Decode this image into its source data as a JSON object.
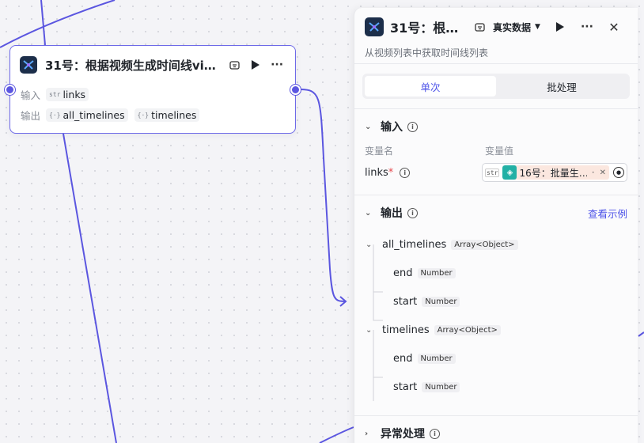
{
  "node": {
    "title": "31号：根据视频生成时间线vi…",
    "input_label": "输入",
    "output_label": "输出",
    "inputs": [
      {
        "icon": "str",
        "name": "links"
      }
    ],
    "outputs": [
      {
        "icon": "{·}",
        "name": "all_timelines"
      },
      {
        "icon": "{·}",
        "name": "timelines"
      }
    ]
  },
  "panel": {
    "title": "31号：根…",
    "data_mode": "真实数据",
    "description": "从视频列表中获取时间线列表",
    "tabs": [
      "单次",
      "批处理"
    ],
    "input_section": {
      "title": "输入",
      "col_name": "变量名",
      "col_value": "变量值",
      "var_name": "links",
      "required_mark": "*",
      "var_type_icon": "str",
      "ref_label": "16号：批量生…",
      "ref_suffix": "·"
    },
    "output_section": {
      "title": "输出",
      "view_example": "查看示例",
      "tree": [
        {
          "name": "all_timelines",
          "type": "Array<Object>",
          "children": [
            {
              "name": "end",
              "type": "Number"
            },
            {
              "name": "start",
              "type": "Number"
            }
          ]
        },
        {
          "name": "timelines",
          "type": "Array<Object>",
          "children": [
            {
              "name": "end",
              "type": "Number"
            },
            {
              "name": "start",
              "type": "Number"
            }
          ]
        }
      ]
    },
    "exception_section": {
      "title": "异常处理"
    }
  },
  "colors": {
    "accent": "#4d53e8",
    "edge": "#5b56e0",
    "ref_chip": "#fbe7df",
    "ref_icon": "#22b0a5"
  }
}
